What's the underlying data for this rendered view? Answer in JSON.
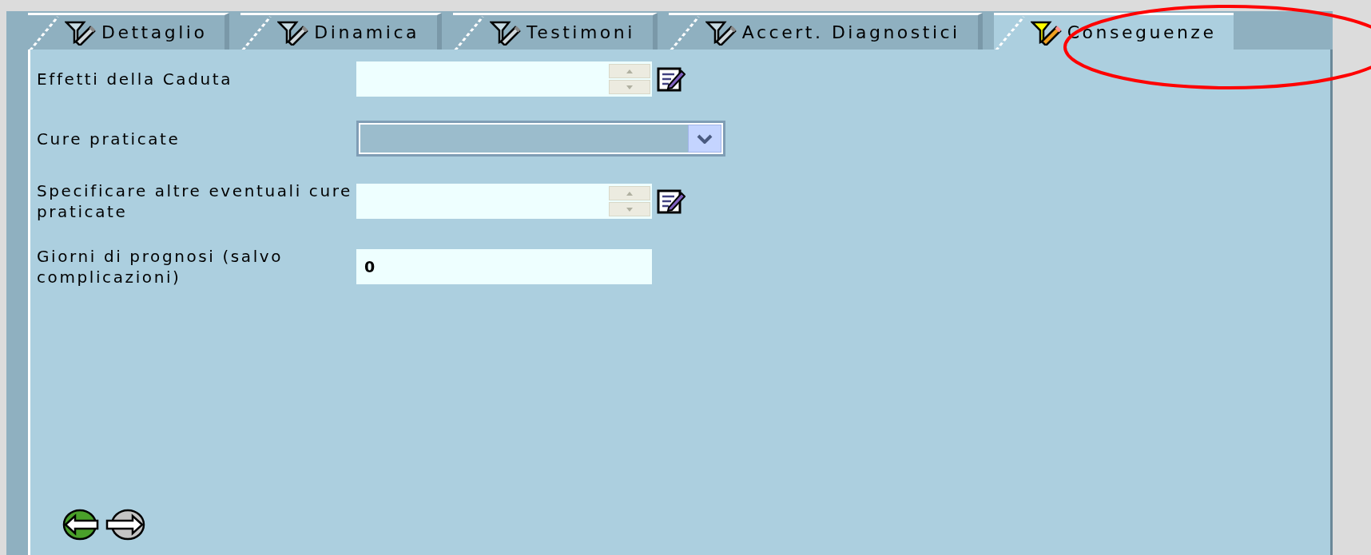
{
  "tabs": [
    {
      "label": "Dettaglio",
      "selected": false
    },
    {
      "label": "Dinamica",
      "selected": false
    },
    {
      "label": "Testimoni",
      "selected": false
    },
    {
      "label": "Accert. Diagnostici",
      "selected": false
    },
    {
      "label": "Conseguenze",
      "selected": true
    }
  ],
  "fields": [
    {
      "kind": "memo",
      "label": "Effetti della Caduta"
    },
    {
      "kind": "select",
      "label": "Cure praticate"
    },
    {
      "kind": "memo",
      "label": "Specificare altre eventuali cure praticate"
    },
    {
      "kind": "text",
      "label": "Giorni di prognosi (salvo complicazioni)",
      "value": "0"
    }
  ]
}
